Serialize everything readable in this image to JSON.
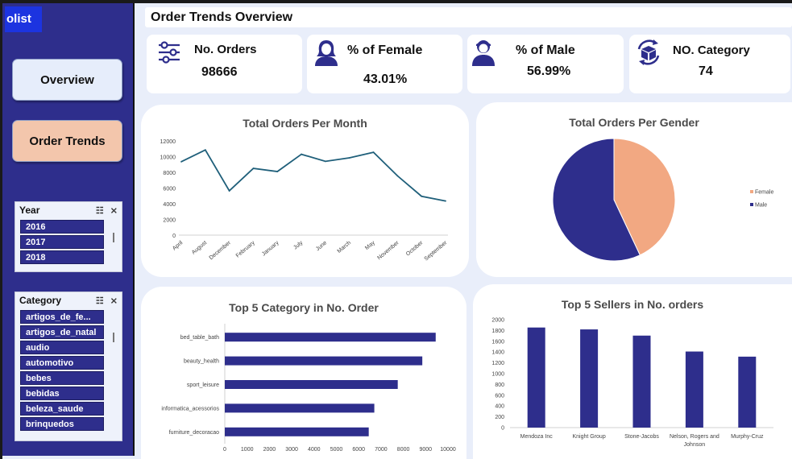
{
  "app": {
    "logo_text": "olist",
    "page_title": "Order Trends Overview"
  },
  "nav": {
    "overview_label": "Overview",
    "order_trends_label": "Order Trends"
  },
  "year_slicer": {
    "title": "Year",
    "items": [
      "2016",
      "2017",
      "2018"
    ]
  },
  "category_slicer": {
    "title": "Category",
    "items": [
      "artigos_de_fe...",
      "artigos_de_natal",
      "audio",
      "automotivo",
      "bebes",
      "bebidas",
      "beleza_saude",
      "brinquedos"
    ]
  },
  "kpis": {
    "orders": {
      "label": "No. Orders",
      "value": "98666"
    },
    "female": {
      "label": "% of Female",
      "value": "43.01%"
    },
    "male": {
      "label": "% of Male",
      "value": "56.99%"
    },
    "category": {
      "label": "NO. Category",
      "value": "74"
    }
  },
  "colors": {
    "navy": "#2e2e8c",
    "peach": "#f2a882",
    "line": "#1f5f7a",
    "sidebar": "#2e2e8c"
  },
  "chart_data": [
    {
      "type": "line",
      "title": "Total Orders Per Month",
      "categories": [
        "April",
        "August",
        "December",
        "February",
        "January",
        "July",
        "June",
        "March",
        "May",
        "November",
        "October",
        "September"
      ],
      "values": [
        9350,
        10850,
        5650,
        8500,
        8100,
        10300,
        9400,
        9850,
        10550,
        7550,
        4950,
        4350
      ],
      "ylim": [
        0,
        12000
      ],
      "yticks": [
        "0",
        "2000",
        "4000",
        "6000",
        "8000",
        "10000",
        "12000"
      ],
      "grid": false
    },
    {
      "type": "pie",
      "title": "Total Orders Per Gender",
      "slices": [
        {
          "name": "Female",
          "value": 43.01
        },
        {
          "name": "Male",
          "value": 56.99
        }
      ],
      "legend": "right"
    },
    {
      "type": "bar",
      "orientation": "horizontal",
      "title": "Top 5 Category in No. Order",
      "categories": [
        "bed_table_bath",
        "beauty_health",
        "sport_leisure",
        "informatica_acessorios",
        "furniture_decoracao"
      ],
      "values": [
        9450,
        8850,
        7750,
        6700,
        6450
      ],
      "xlim": [
        0,
        10000
      ],
      "xticks": [
        "0",
        "1000",
        "2000",
        "3000",
        "4000",
        "5000",
        "6000",
        "7000",
        "8000",
        "9000",
        "10000"
      ]
    },
    {
      "type": "bar",
      "title": "Top 5 Sellers in No. orders",
      "categories": [
        "Mendoza Inc",
        "Knight Group",
        "Stone-Jacobs",
        "Nelson, Rogers and Johnson",
        "Murphy-Cruz"
      ],
      "values": [
        1855,
        1820,
        1705,
        1410,
        1315
      ],
      "ylim": [
        0,
        2000
      ],
      "yticks": [
        "0",
        "200",
        "400",
        "600",
        "800",
        "1000",
        "1200",
        "1400",
        "1600",
        "1800",
        "2000"
      ]
    }
  ]
}
